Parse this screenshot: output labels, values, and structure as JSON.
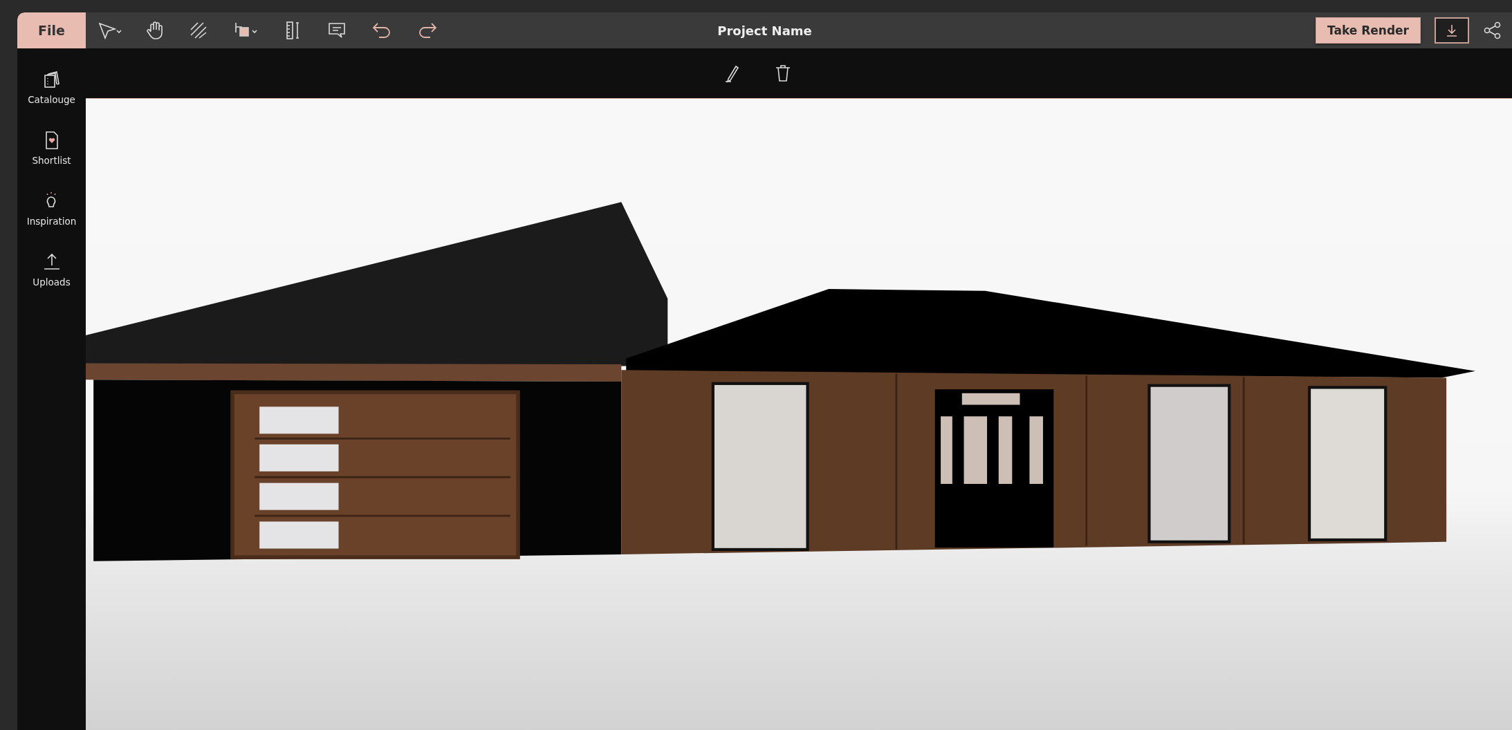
{
  "toolbar": {
    "file_button": "File",
    "title": "Project Name",
    "render_button": "Take Render"
  },
  "sidebar": {
    "items": [
      {
        "label": "Catalouge"
      },
      {
        "label": "Shortlist"
      },
      {
        "label": "Inspiration"
      },
      {
        "label": "Uploads"
      }
    ]
  }
}
